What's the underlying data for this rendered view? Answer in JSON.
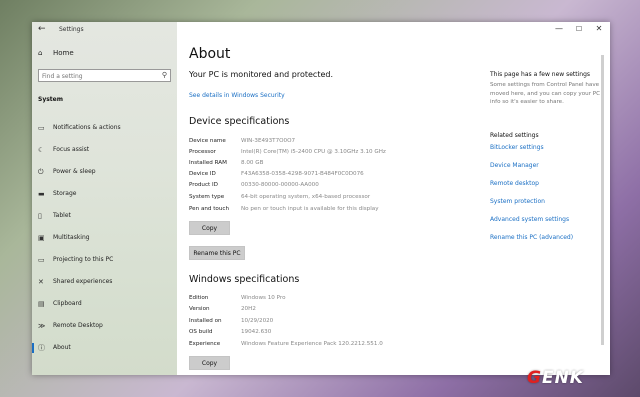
{
  "window": {
    "app_title": "Settings",
    "controls": {
      "minimize": "—",
      "maximize": "☐",
      "close": "✕"
    }
  },
  "sidebar": {
    "home_label": "Home",
    "search_placeholder": "Find a setting",
    "section_label": "System",
    "items": [
      {
        "label": "Notifications & actions",
        "icon": "notifications-icon"
      },
      {
        "label": "Focus assist",
        "icon": "focus-assist-icon"
      },
      {
        "label": "Power & sleep",
        "icon": "power-icon"
      },
      {
        "label": "Storage",
        "icon": "storage-icon"
      },
      {
        "label": "Tablet",
        "icon": "tablet-icon"
      },
      {
        "label": "Multitasking",
        "icon": "multitasking-icon"
      },
      {
        "label": "Projecting to this PC",
        "icon": "projecting-icon"
      },
      {
        "label": "Shared experiences",
        "icon": "shared-experiences-icon"
      },
      {
        "label": "Clipboard",
        "icon": "clipboard-icon"
      },
      {
        "label": "Remote Desktop",
        "icon": "remote-desktop-icon"
      },
      {
        "label": "About",
        "icon": "info-icon",
        "active": true
      }
    ]
  },
  "main": {
    "title": "About",
    "monitored": "Your PC is monitored and protected.",
    "security_link": "See details in Windows Security",
    "device_specs": {
      "heading": "Device specifications",
      "rows": [
        {
          "key": "Device name",
          "value": "WIN-3E493T7O0O7"
        },
        {
          "key": "Processor",
          "value": "Intel(R) Core(TM) i5-2400 CPU @ 3.10GHz   3.10 GHz"
        },
        {
          "key": "Installed RAM",
          "value": "8.00 GB"
        },
        {
          "key": "Device ID",
          "value": "F43A6358-0358-4298-9071-B484F0C0D076"
        },
        {
          "key": "Product ID",
          "value": "00330-80000-00000-AA000"
        },
        {
          "key": "System type",
          "value": "64-bit operating system, x64-based processor"
        },
        {
          "key": "Pen and touch",
          "value": "No pen or touch input is available for this display"
        }
      ],
      "copy_button": "Copy",
      "rename_button": "Rename this PC"
    },
    "windows_specs": {
      "heading": "Windows specifications",
      "rows": [
        {
          "key": "Edition",
          "value": "Windows 10 Pro"
        },
        {
          "key": "Version",
          "value": "20H2"
        },
        {
          "key": "Installed on",
          "value": "10/29/2020"
        },
        {
          "key": "OS build",
          "value": "19042.630"
        },
        {
          "key": "Experience",
          "value": "Windows Feature Experience Pack 120.2212.551.0"
        }
      ],
      "copy_button": "Copy"
    }
  },
  "right_panel": {
    "heading": "This page has a few new settings",
    "body": "Some settings from Control Panel have moved here, and you can copy your PC info so it's easier to share.",
    "related_heading": "Related settings",
    "links": [
      "BitLocker settings",
      "Device Manager",
      "Remote desktop",
      "System protection",
      "Advanced system settings",
      "Rename this PC (advanced)"
    ]
  },
  "watermark": {
    "first": "G",
    "rest": "ENK"
  },
  "colors": {
    "accent": "#1a6fc4",
    "button_bg": "#cccccc",
    "value_text": "#888888"
  }
}
